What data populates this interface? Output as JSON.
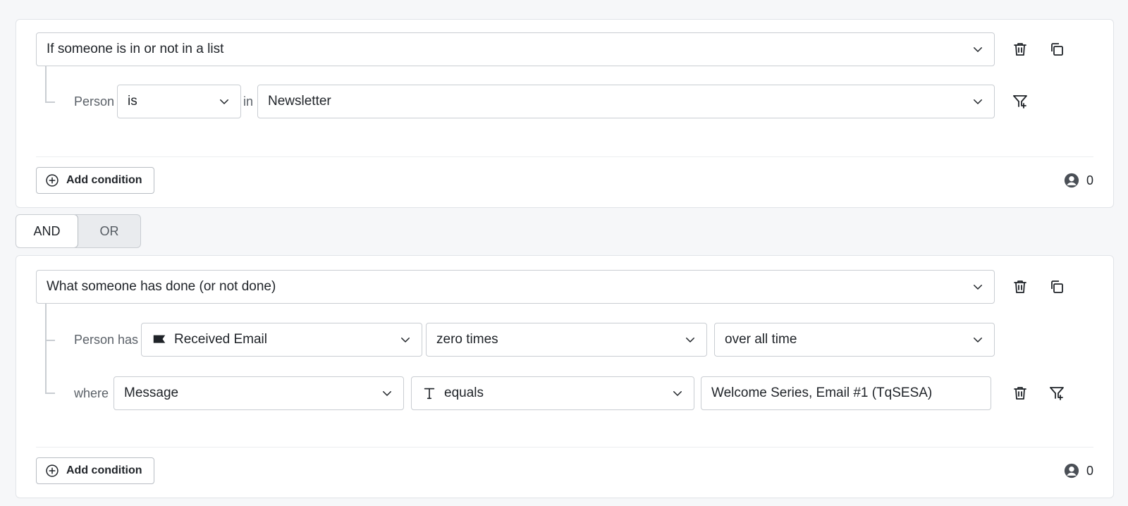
{
  "group1": {
    "condition_type": "If someone is in or not in a list",
    "person_label": "Person",
    "operator": "is",
    "in_label": "in",
    "list": "Newsletter",
    "add_condition_label": "Add condition",
    "count": "0"
  },
  "logic_toggle": {
    "and_label": "AND",
    "or_label": "OR",
    "selected": "AND"
  },
  "group2": {
    "condition_type": "What someone has done (or not done)",
    "person_has_label": "Person has",
    "metric": "Received Email",
    "frequency": "zero times",
    "timeframe": "over all time",
    "where_label": "where",
    "property": "Message",
    "comparator": "equals",
    "value": "Welcome Series, Email #1 (TqSESA)",
    "add_condition_label": "Add condition",
    "count": "0"
  },
  "icons": {
    "chevron": "chevron-down-icon",
    "delete": "trash-icon",
    "duplicate": "copy-icon",
    "filter_add": "filter-plus-icon",
    "add": "plus-circle-icon",
    "person": "person-circle-icon",
    "metric": "flag-icon",
    "text_type": "text-type-icon"
  },
  "colors": {
    "border": "#c9cdd2",
    "text": "#1f2328",
    "muted": "#5b6168",
    "background": "#f6f7f9"
  }
}
